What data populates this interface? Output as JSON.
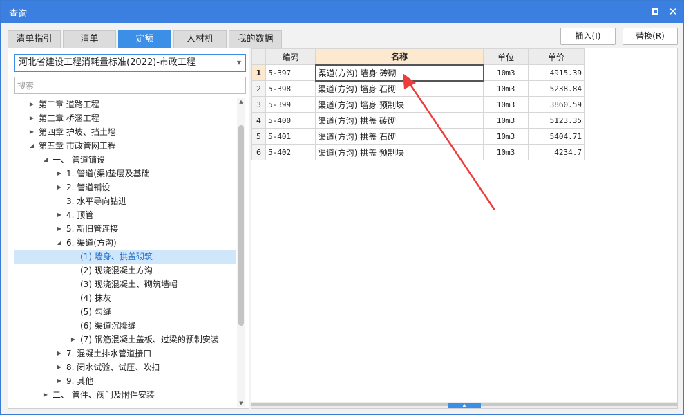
{
  "window": {
    "title": "查询",
    "maximize_icon": "maximize-icon",
    "close_icon": "close-icon",
    "close_glyph": "✕"
  },
  "tabs": [
    {
      "label": "清单指引",
      "active": false
    },
    {
      "label": "清单",
      "active": false
    },
    {
      "label": "定额",
      "active": true
    },
    {
      "label": "人材机",
      "active": false
    },
    {
      "label": "我的数据",
      "active": false
    }
  ],
  "actions": {
    "insert": "插入(I)",
    "replace": "替换(R)"
  },
  "library": {
    "selected": "河北省建设工程消耗量标准(2022)-市政工程"
  },
  "search": {
    "placeholder": "搜索",
    "value": ""
  },
  "tree": [
    {
      "label": "第二章 道路工程",
      "arrow": "▶",
      "selected": false
    },
    {
      "label": "第三章 桥涵工程",
      "arrow": "▶",
      "selected": false
    },
    {
      "label": "第四章 护坡、挡土墙",
      "arrow": "▶",
      "selected": false
    },
    {
      "label": "第五章 市政管网工程",
      "arrow": "◢",
      "selected": false
    },
    {
      "label": "一、 管道铺设",
      "arrow": "◢",
      "selected": false
    },
    {
      "label": "1. 管道(渠)垫层及基础",
      "arrow": "▶",
      "selected": false
    },
    {
      "label": "2. 管道铺设",
      "arrow": "▶",
      "selected": false
    },
    {
      "label": "3. 水平导向钻进",
      "arrow": "",
      "selected": false
    },
    {
      "label": "4. 顶管",
      "arrow": "▶",
      "selected": false
    },
    {
      "label": "5. 新旧管连接",
      "arrow": "▶",
      "selected": false
    },
    {
      "label": "6. 渠道(方沟)",
      "arrow": "◢",
      "selected": false
    },
    {
      "label": "(1) 墙身、拱盖砌筑",
      "arrow": "",
      "selected": true
    },
    {
      "label": "(2) 现浇混凝土方沟",
      "arrow": "",
      "selected": false
    },
    {
      "label": "(3) 现浇混凝土、砌筑墙帽",
      "arrow": "",
      "selected": false
    },
    {
      "label": "(4) 抹灰",
      "arrow": "",
      "selected": false
    },
    {
      "label": "(5) 勾缝",
      "arrow": "",
      "selected": false
    },
    {
      "label": "(6) 渠道沉降缝",
      "arrow": "",
      "selected": false
    },
    {
      "label": "(7) 钢筋混凝土盖板、过梁的预制安装",
      "arrow": "▶",
      "selected": false
    },
    {
      "label": "7. 混凝土排水管道接口",
      "arrow": "▶",
      "selected": false
    },
    {
      "label": "8. 闭水试验、试压、吹扫",
      "arrow": "▶",
      "selected": false
    },
    {
      "label": "9. 其他",
      "arrow": "▶",
      "selected": false
    },
    {
      "label": "二、 管件、阀门及附件安装",
      "arrow": "▶",
      "selected": false
    }
  ],
  "grid": {
    "headers": [
      "",
      "编码",
      "名称",
      "单位",
      "单价"
    ],
    "rows": [
      {
        "idx": "1",
        "code": "5-397",
        "name": "渠道(方沟) 墙身 砖砌",
        "unit": "10m3",
        "price": "4915.39"
      },
      {
        "idx": "2",
        "code": "5-398",
        "name": "渠道(方沟) 墙身 石砌",
        "unit": "10m3",
        "price": "5238.84"
      },
      {
        "idx": "3",
        "code": "5-399",
        "name": "渠道(方沟) 墙身 预制块",
        "unit": "10m3",
        "price": "3860.59"
      },
      {
        "idx": "4",
        "code": "5-400",
        "name": "渠道(方沟) 拱盖 砖砌",
        "unit": "10m3",
        "price": "5123.35"
      },
      {
        "idx": "5",
        "code": "5-401",
        "name": "渠道(方沟) 拱盖 石砌",
        "unit": "10m3",
        "price": "5404.71"
      },
      {
        "idx": "6",
        "code": "5-402",
        "name": "渠道(方沟) 拱盖 预制块",
        "unit": "10m3",
        "price": "4234.7"
      }
    ]
  },
  "colors": {
    "accent": "#3b8fe6",
    "titlebar": "#3b7fe0",
    "selection": "#cfe6fb",
    "header_highlight": "#fde9cf",
    "annotation": "#ee3b3b"
  }
}
